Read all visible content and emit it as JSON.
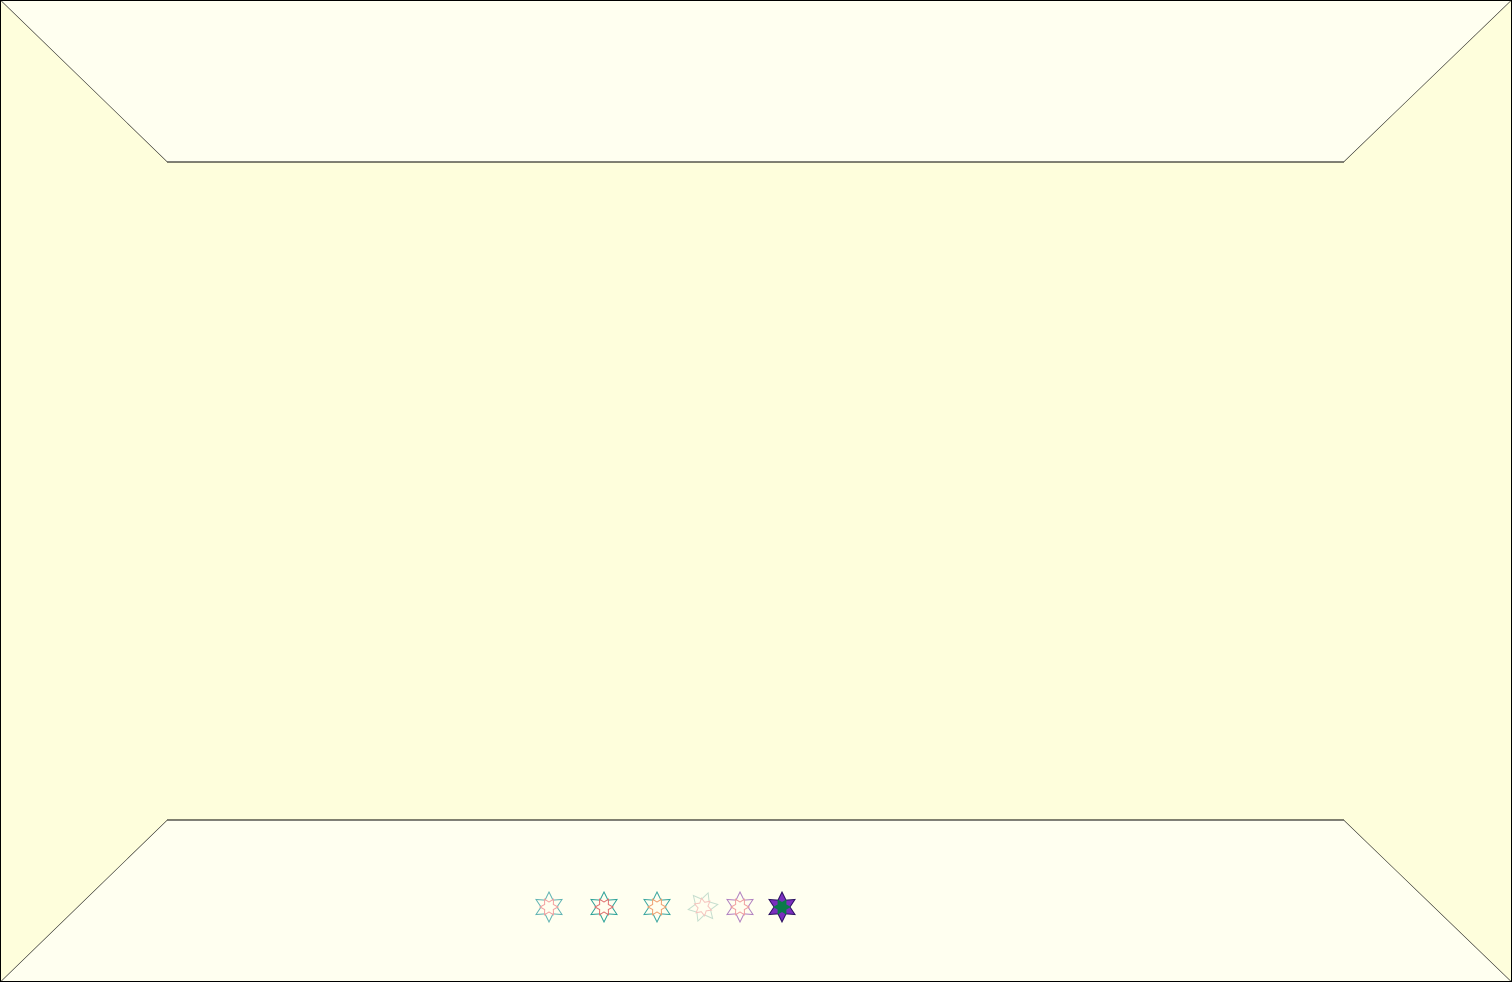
{
  "page": {
    "background": "#fefee0",
    "panel_color": "#fffff0",
    "center_color": "#fefedc",
    "line_color": "#000000"
  },
  "stars": [
    {
      "name": "star-icon-1",
      "style": "outline",
      "outer": "#5fb3b3",
      "inner": "#f4a0a0",
      "rotated": false,
      "faded": false
    },
    {
      "name": "star-icon-2",
      "style": "outline",
      "outer": "#2aa198",
      "inner": "#e07070",
      "rotated": false,
      "faded": false
    },
    {
      "name": "star-icon-3",
      "style": "outline",
      "outer": "#3aa6a0",
      "inner": "#f0a070",
      "rotated": false,
      "faded": false
    },
    {
      "name": "star-icon-4",
      "style": "outline",
      "outer": "#a0c8b8",
      "inner": "#f0a0a0",
      "rotated": true,
      "faded": true
    },
    {
      "name": "star-icon-5",
      "style": "outline",
      "outer": "#b080c0",
      "inner": "#f0a0a0",
      "rotated": false,
      "faded": false
    },
    {
      "name": "star-icon-6",
      "style": "filled",
      "outer": "#7b2fbf",
      "inner": "#0a7a4a",
      "rotated": false,
      "faded": false
    }
  ]
}
